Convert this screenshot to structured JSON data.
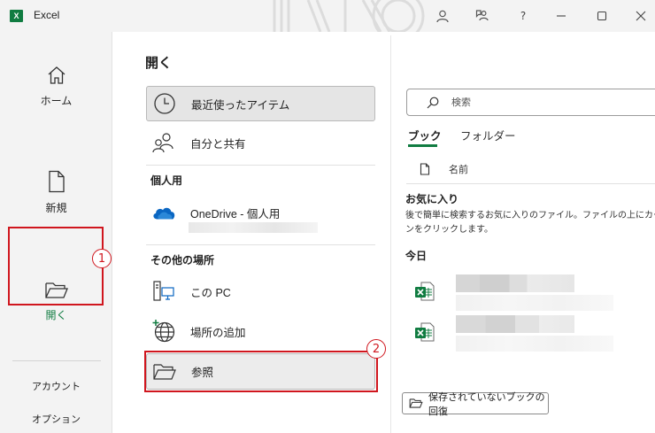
{
  "app": {
    "logo": "X",
    "title": "Excel"
  },
  "titlebar": {
    "help": "?"
  },
  "nav": {
    "home": "ホーム",
    "new": "新規",
    "open": "開く",
    "account": "アカウント",
    "options": "オプション"
  },
  "page": {
    "heading": "開く"
  },
  "locations": {
    "recent": "最近使ったアイテム",
    "shared": "自分と共有",
    "personal_section": "個人用",
    "onedrive": "OneDrive - 個人用",
    "other_section": "その他の場所",
    "this_pc": "この PC",
    "add_place": "場所の追加",
    "browse": "参照"
  },
  "callouts": {
    "one": "1",
    "two": "2"
  },
  "search": {
    "placeholder": "検索"
  },
  "tabs": {
    "book": "ブック",
    "folder": "フォルダー"
  },
  "list": {
    "name_header": "名前",
    "favorites_title": "お気に入り",
    "favorites_desc_1": "後で簡単に検索するお気に入りのファイル。ファイルの上にカーソル",
    "favorites_desc_2": "ンをクリックします。",
    "today": "今日"
  },
  "recover_button": "保存されていないブックの回復",
  "colors": {
    "excel_green": "#107c41",
    "highlight_red": "#d0161e",
    "onedrive_blue": "#0a66c2"
  },
  "icons": [
    "home-icon",
    "new-file-icon",
    "open-folder-icon",
    "clock-icon",
    "people-icon",
    "onedrive-cloud-icon",
    "this-pc-icon",
    "globe-add-icon",
    "folder-icon",
    "search-icon",
    "file-icon",
    "excel-file-icon"
  ]
}
